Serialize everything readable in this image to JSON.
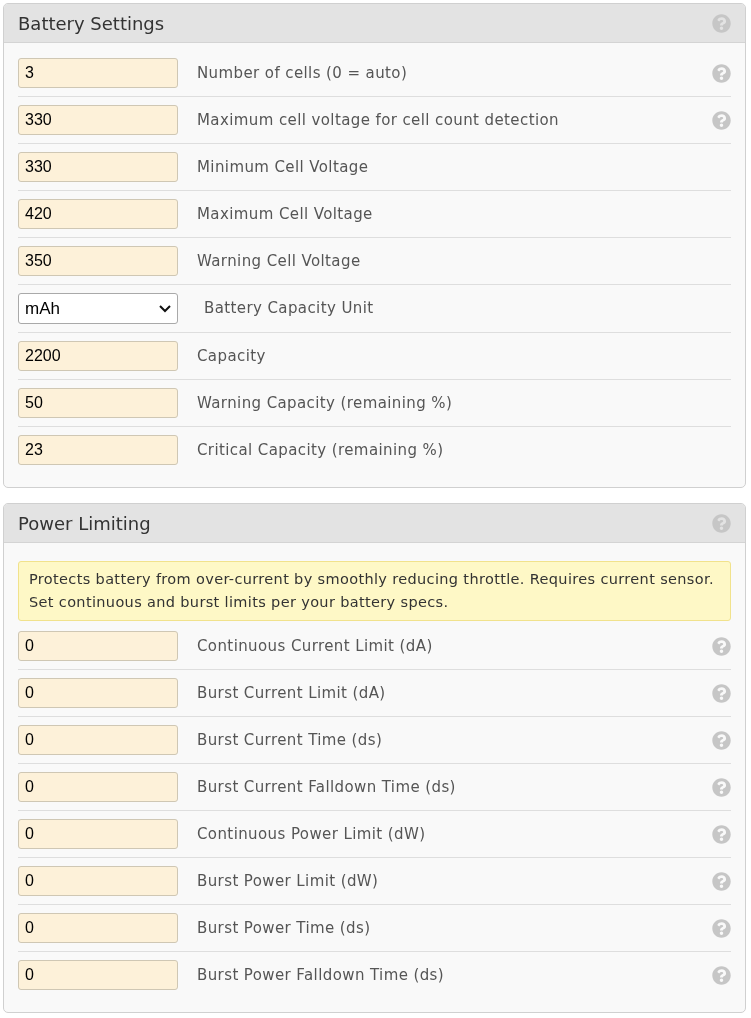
{
  "panels": [
    {
      "title": "Battery Settings",
      "help": true,
      "rows": [
        {
          "kind": "input",
          "value": "3",
          "label": "Number of cells (0 = auto)",
          "help": true
        },
        {
          "kind": "input",
          "value": "330",
          "label": "Maximum cell voltage for cell count detection",
          "help": true
        },
        {
          "kind": "input",
          "value": "330",
          "label": "Minimum Cell Voltage",
          "help": false
        },
        {
          "kind": "input",
          "value": "420",
          "label": "Maximum Cell Voltage",
          "help": false
        },
        {
          "kind": "input",
          "value": "350",
          "label": "Warning Cell Voltage",
          "help": false
        },
        {
          "kind": "select",
          "value": "mAh",
          "label": "Battery Capacity Unit",
          "help": false
        },
        {
          "kind": "input",
          "value": "2200",
          "label": "Capacity",
          "help": false
        },
        {
          "kind": "input",
          "value": "50",
          "label": "Warning Capacity (remaining %)",
          "help": false
        },
        {
          "kind": "input",
          "value": "23",
          "label": "Critical Capacity (remaining %)",
          "help": false
        }
      ]
    },
    {
      "title": "Power Limiting",
      "help": true,
      "note": "Protects battery from over-current by smoothly reducing throttle. Requires current sensor. Set continuous and burst limits per your battery specs.",
      "rows": [
        {
          "kind": "input",
          "value": "0",
          "label": "Continuous Current Limit (dA)",
          "help": true
        },
        {
          "kind": "input",
          "value": "0",
          "label": "Burst Current Limit (dA)",
          "help": true
        },
        {
          "kind": "input",
          "value": "0",
          "label": "Burst Current Time (ds)",
          "help": true
        },
        {
          "kind": "input",
          "value": "0",
          "label": "Burst Current Falldown Time (ds)",
          "help": true
        },
        {
          "kind": "input",
          "value": "0",
          "label": "Continuous Power Limit (dW)",
          "help": true
        },
        {
          "kind": "input",
          "value": "0",
          "label": "Burst Power Limit (dW)",
          "help": true
        },
        {
          "kind": "input",
          "value": "0",
          "label": "Burst Power Time (ds)",
          "help": true
        },
        {
          "kind": "input",
          "value": "0",
          "label": "Burst Power Falldown Time (ds)",
          "help": true
        }
      ]
    }
  ]
}
